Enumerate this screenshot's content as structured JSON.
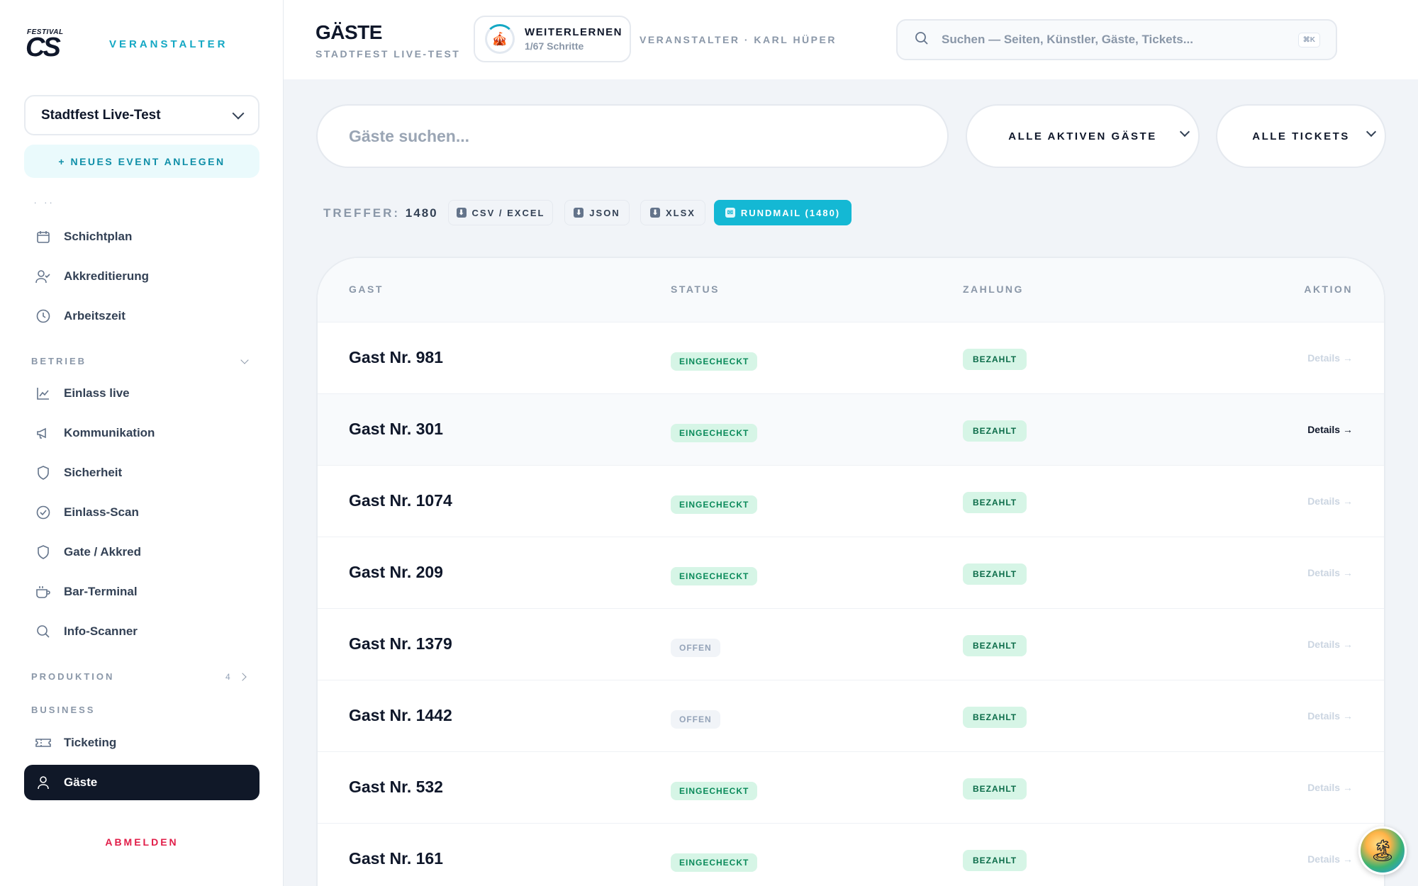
{
  "brand": {
    "logo_small": "FESTIVAL",
    "logo_big": "CS",
    "role": "VERANSTALTER"
  },
  "sidebar": {
    "event_selected": "Stadtfest Live-Test",
    "new_event": "+ NEUES EVENT ANLEGEN",
    "dots": ". ..",
    "items_top": [
      {
        "label": "Schichtplan",
        "icon": "calendar-icon"
      },
      {
        "label": "Akkreditierung",
        "icon": "user-check-icon"
      },
      {
        "label": "Arbeitszeit",
        "icon": "clock-icon"
      }
    ],
    "section_betrieb": "BETRIEB",
    "items_betrieb": [
      {
        "label": "Einlass live",
        "icon": "chart-line-icon"
      },
      {
        "label": "Kommunikation",
        "icon": "megaphone-icon"
      },
      {
        "label": "Sicherheit",
        "icon": "shield-icon"
      },
      {
        "label": "Einlass-Scan",
        "icon": "check-circle-icon"
      },
      {
        "label": "Gate / Akkred",
        "icon": "shield-icon"
      },
      {
        "label": "Bar-Terminal",
        "icon": "cup-icon"
      },
      {
        "label": "Info-Scanner",
        "icon": "search-icon"
      }
    ],
    "section_produktion": "PRODUKTION",
    "produktion_count": "4",
    "section_business": "BUSINESS",
    "items_business": [
      {
        "label": "Ticketing",
        "icon": "ticket-icon"
      },
      {
        "label": "Gäste",
        "icon": "user-icon"
      }
    ],
    "logout": "ABMELDEN"
  },
  "header": {
    "title": "GÄSTE",
    "subtitle": "STADTFEST LIVE-TEST",
    "learn_title": "WEITERLERNEN",
    "learn_steps": "1/67 Schritte",
    "organizer": "VERANSTALTER · KARL HÜPER",
    "search_placeholder": "Suchen — Seiten, Künstler, Gäste, Tickets...",
    "search_kbd": "⌘K"
  },
  "filters": {
    "guest_search_placeholder": "Gäste suchen...",
    "status_filter": "ALLE AKTIVEN GÄSTE",
    "ticket_filter": "ALLE TICKETS"
  },
  "results": {
    "hits_label": "TREFFER:",
    "hits_count": "1480",
    "export_csv": "CSV / EXCEL",
    "export_json": "JSON",
    "export_xlsx": "XLSX",
    "mail": "RUNDMAIL (1480)"
  },
  "table": {
    "headers": {
      "guest": "GAST",
      "status": "STATUS",
      "payment": "ZAHLUNG",
      "action": "AKTION"
    },
    "rows": [
      {
        "name": "Gast Nr. 981",
        "status": "EINGECHECKT",
        "payment": "BEZAHLT",
        "action": "Details →"
      },
      {
        "name": "Gast Nr. 301",
        "status": "EINGECHECKT",
        "payment": "BEZAHLT",
        "action": "Details →"
      },
      {
        "name": "Gast Nr. 1074",
        "status": "EINGECHECKT",
        "payment": "BEZAHLT",
        "action": "Details →"
      },
      {
        "name": "Gast Nr. 209",
        "status": "EINGECHECKT",
        "payment": "BEZAHLT",
        "action": "Details →"
      },
      {
        "name": "Gast Nr. 1379",
        "status": "OFFEN",
        "payment": "BEZAHLT",
        "action": "Details →"
      },
      {
        "name": "Gast Nr. 1442",
        "status": "OFFEN",
        "payment": "BEZAHLT",
        "action": "Details →"
      },
      {
        "name": "Gast Nr. 532",
        "status": "EINGECHECKT",
        "payment": "BEZAHLT",
        "action": "Details →"
      },
      {
        "name": "Gast Nr. 161",
        "status": "EINGECHECKT",
        "payment": "BEZAHLT",
        "action": "Details →"
      }
    ]
  },
  "colors": {
    "accent": "#14b8d4",
    "dark": "#101828",
    "danger": "#e11d48",
    "success_bg": "#d6f5e6"
  }
}
